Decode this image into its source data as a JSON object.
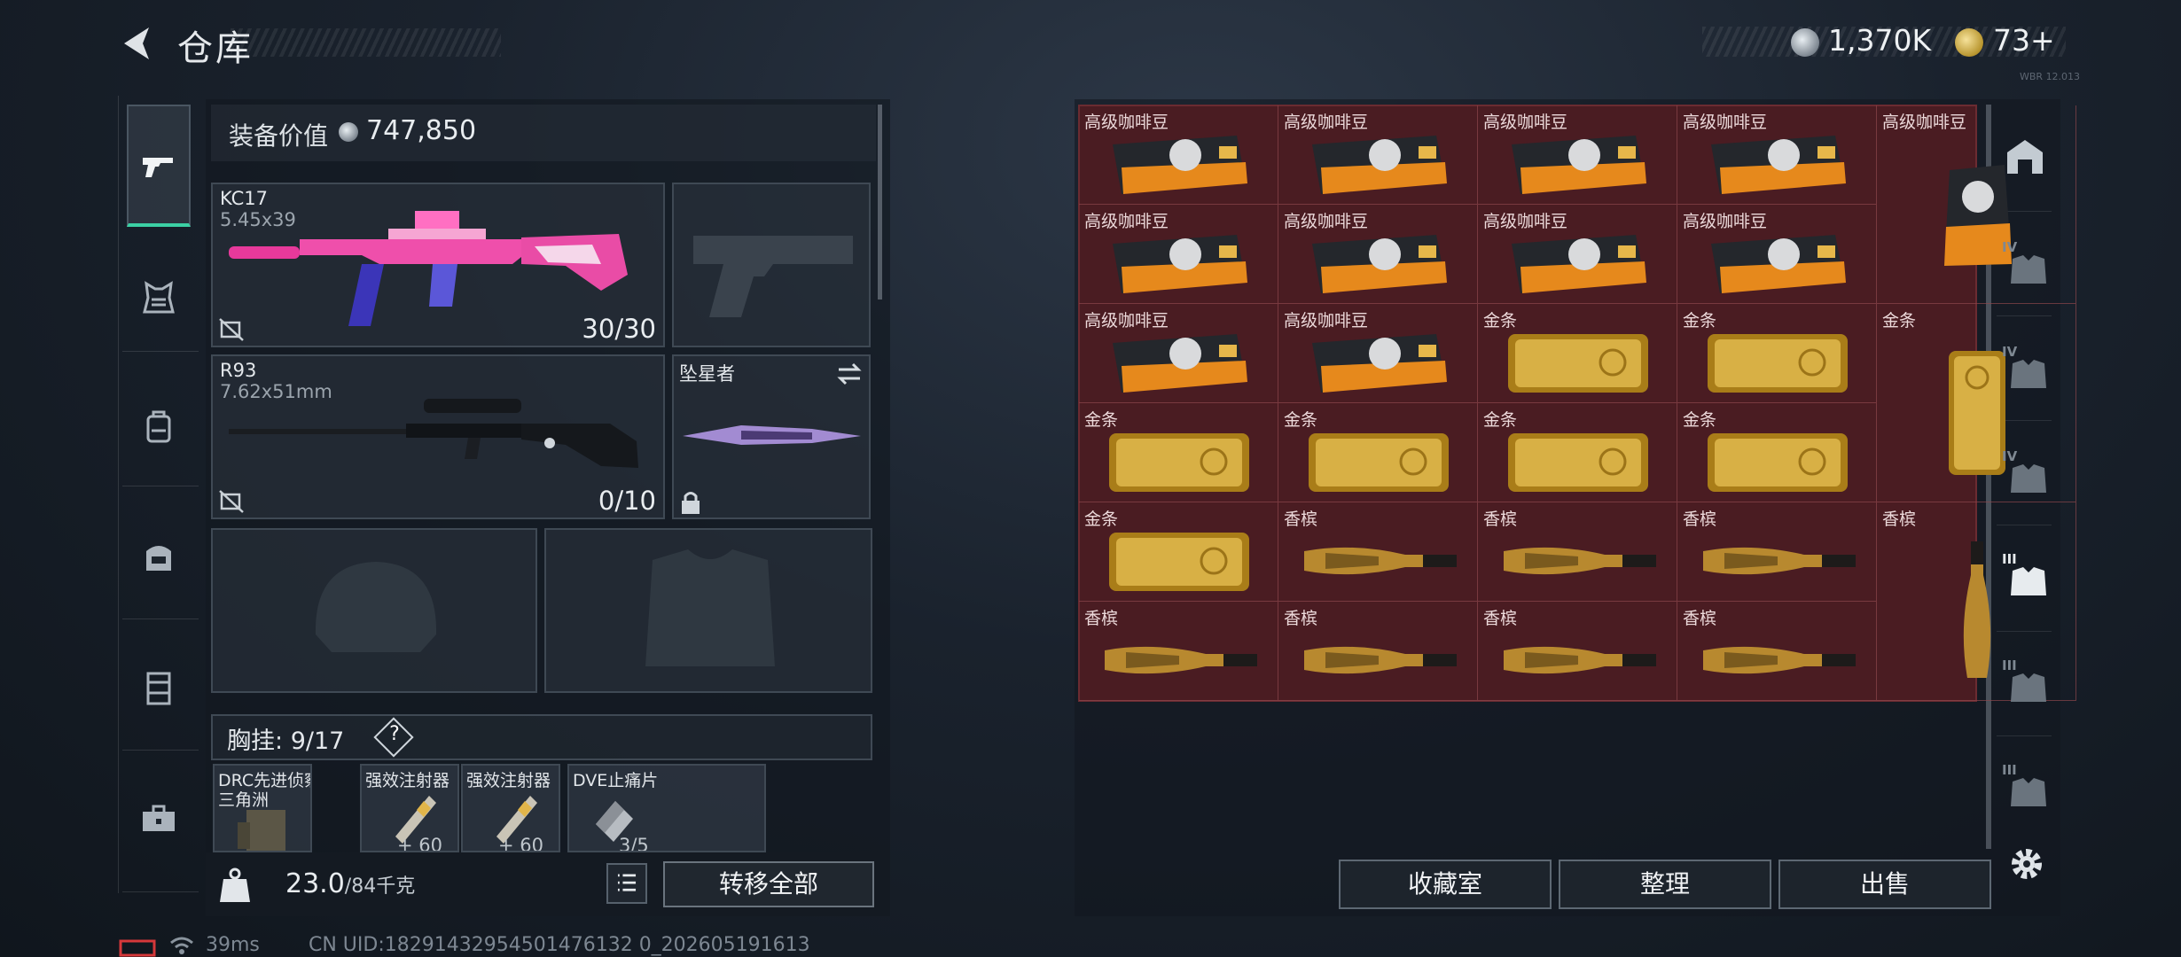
{
  "header": {
    "title": "仓库",
    "currency_silver": "1,370K",
    "currency_gold": "73",
    "plus": "+",
    "tiny_text": "WBR 12.013"
  },
  "left_nav": {
    "items": [
      "pistol-icon",
      "gear-vest-icon",
      "backpack-icon",
      "bag-icon",
      "armor-case-icon",
      "toolbox-icon"
    ]
  },
  "equipment": {
    "value_label": "装备价值",
    "value": "747,850",
    "primary": {
      "name": "KC17",
      "caliber": "5.45x39",
      "ammo": "30/30"
    },
    "secondary": {
      "name": "R93",
      "caliber": "7.62x51mm",
      "ammo": "0/10"
    },
    "melee": {
      "name": "坠星者"
    },
    "chest": {
      "label": "胸挂:",
      "capacity": "9/17",
      "help": "?"
    },
    "chest_items": [
      {
        "name": "DRC先进侦察...",
        "sub": "三角洲"
      },
      {
        "name": "强效注射器",
        "qty": "60"
      },
      {
        "name": "强效注射器",
        "qty": "60"
      },
      {
        "name": "DVE止痛片",
        "qty": "3/5"
      }
    ],
    "weight": "23.0",
    "weight_max": "/84千克",
    "transfer_all": "转移全部"
  },
  "storage": {
    "items": [
      {
        "name": "高级咖啡豆",
        "type": "coffee"
      },
      {
        "name": "高级咖啡豆",
        "type": "coffee"
      },
      {
        "name": "高级咖啡豆",
        "type": "coffee"
      },
      {
        "name": "高级咖啡豆",
        "type": "coffee"
      },
      {
        "name": "高级咖啡豆",
        "type": "coffee-tall"
      },
      {
        "name": "高级咖啡豆",
        "type": "coffee"
      },
      {
        "name": "高级咖啡豆",
        "type": "coffee"
      },
      {
        "name": "高级咖啡豆",
        "type": "coffee"
      },
      {
        "name": "高级咖啡豆",
        "type": "coffee"
      },
      {
        "name": "高级咖啡豆",
        "type": "coffee"
      },
      {
        "name": "高级咖啡豆",
        "type": "coffee"
      },
      {
        "name": "金条",
        "type": "gold"
      },
      {
        "name": "金条",
        "type": "gold"
      },
      {
        "name": "金条",
        "type": "gold-tall"
      },
      {
        "name": "金条",
        "type": "gold"
      },
      {
        "name": "金条",
        "type": "gold"
      },
      {
        "name": "金条",
        "type": "gold"
      },
      {
        "name": "金条",
        "type": "gold"
      },
      {
        "name": "金条",
        "type": "gold"
      },
      {
        "name": "香槟",
        "type": "champ"
      },
      {
        "name": "香槟",
        "type": "champ"
      },
      {
        "name": "香槟",
        "type": "champ"
      },
      {
        "name": "香槟",
        "type": "champ-tall"
      },
      {
        "name": "香槟",
        "type": "champ"
      },
      {
        "name": "香槟",
        "type": "champ"
      },
      {
        "name": "香槟",
        "type": "champ"
      },
      {
        "name": "香槟",
        "type": "champ"
      }
    ],
    "buttons": {
      "collection": "收藏室",
      "sort": "整理",
      "sell": "出售"
    }
  },
  "right_nav": {
    "tier_labels": [
      "IV",
      "IV",
      "IV",
      "III",
      "III",
      "III"
    ]
  },
  "footer": {
    "ping": "39ms",
    "uid": "CN UID:18291432954501476132 0_202605191613"
  }
}
